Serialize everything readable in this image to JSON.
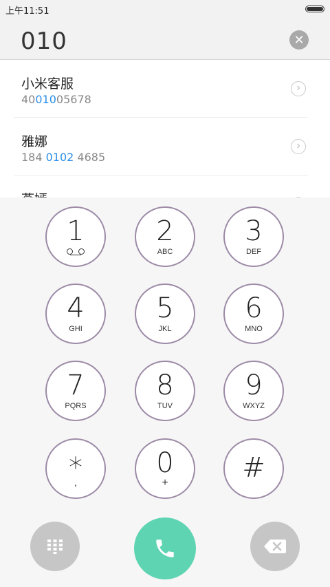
{
  "status": {
    "time": "上午11:51"
  },
  "dial": {
    "number": "010"
  },
  "results": [
    {
      "name": "小米客服",
      "number_prefix": "40",
      "number_match": "010",
      "number_suffix": "05678"
    },
    {
      "name": "雅娜",
      "number_prefix": "184 ",
      "number_match": "0102",
      "number_suffix": " 4685"
    },
    {
      "name": "燕嫣",
      "number_prefix": "",
      "number_match": "",
      "number_suffix": ""
    }
  ],
  "keys": [
    {
      "digit": "1",
      "letters": ""
    },
    {
      "digit": "2",
      "letters": "ABC"
    },
    {
      "digit": "3",
      "letters": "DEF"
    },
    {
      "digit": "4",
      "letters": "GHI"
    },
    {
      "digit": "5",
      "letters": "JKL"
    },
    {
      "digit": "6",
      "letters": "MNO"
    },
    {
      "digit": "7",
      "letters": "PQRS"
    },
    {
      "digit": "8",
      "letters": "TUV"
    },
    {
      "digit": "9",
      "letters": "WXYZ"
    },
    {
      "digit": "*",
      "letters": ","
    },
    {
      "digit": "0",
      "letters": "+"
    },
    {
      "digit": "#",
      "letters": ""
    }
  ],
  "colors": {
    "call": "#5fd4b2",
    "highlight": "#2a8ee8",
    "key_ring": "#9c8aa6"
  },
  "icons": {
    "key1": "voicemail-icon",
    "clear": "clear-icon",
    "call": "phone-icon",
    "delete": "backspace-icon",
    "toggle": "dialpad-icon"
  }
}
